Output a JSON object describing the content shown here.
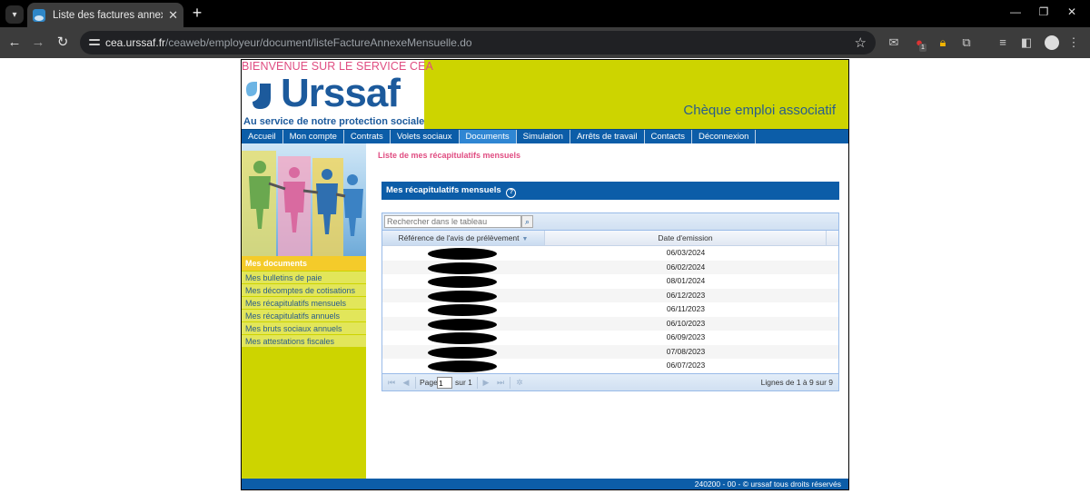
{
  "browser": {
    "tab_title": "Liste des factures annexes men",
    "url_host": "cea.urssaf.fr",
    "url_path": "/ceaweb/employeur/document/listeFactureAnnexeMensuelle.do",
    "ext_badge": "1"
  },
  "header": {
    "welcome": "BIENVENUE SUR LE SERVICE CEA",
    "logo_word": "Urssaf",
    "tagline": "Au service de notre protection sociale",
    "service_name": "Chèque emploi associatif"
  },
  "menu": [
    "Accueil",
    "Mon compte",
    "Contrats",
    "Volets sociaux",
    "Documents",
    "Simulation",
    "Arrêts de travail",
    "Contacts",
    "Déconnexion"
  ],
  "menu_active": "Documents",
  "sidebar": {
    "title": "Mes documents",
    "links": [
      "Mes bulletins de paie",
      "Mes décomptes de cotisations",
      "Mes récapitulatifs mensuels",
      "Mes récapitulatifs annuels",
      "Mes bruts sociaux annuels",
      "Mes attestations fiscales"
    ]
  },
  "content": {
    "title": "Liste de mes récapitulatifs mensuels",
    "panel_title": "Mes récapitulatifs mensuels",
    "search_placeholder": "Rechercher dans le tableau",
    "columns": [
      "Référence de l'avis de prélèvement",
      "Date d'emission"
    ],
    "rows": [
      {
        "date": "06/03/2024"
      },
      {
        "date": "06/02/2024"
      },
      {
        "date": "08/01/2024"
      },
      {
        "date": "06/12/2023"
      },
      {
        "date": "06/11/2023"
      },
      {
        "date": "06/10/2023"
      },
      {
        "date": "06/09/2023"
      },
      {
        "date": "07/08/2023"
      },
      {
        "date": "06/07/2023"
      }
    ],
    "pager": {
      "page_label": "Page",
      "page_value": "1",
      "of_label": "sur 1",
      "info": "Lignes de 1 à 9 sur 9"
    }
  },
  "footer": "240200 - 00 - © urssaf tous droits réservés",
  "colors": {
    "brand_blue": "#0c5da8",
    "lime": "#cdd400",
    "pink": "#e04d82"
  }
}
